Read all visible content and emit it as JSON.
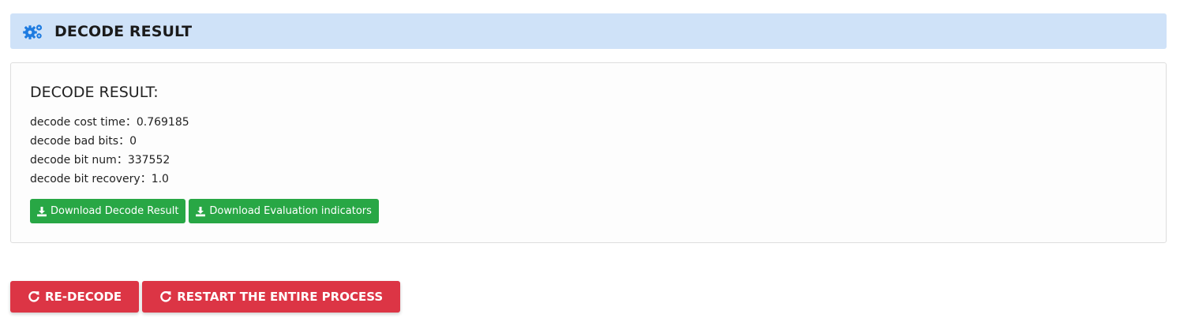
{
  "header": {
    "title": "DECODE RESULT",
    "icon": "gears-icon",
    "background_color": "#cfe2f8",
    "icon_color": "#1e7be0"
  },
  "result": {
    "title": "DECODE RESULT:",
    "stats": [
      {
        "label": "decode cost time：",
        "value": "0.769185"
      },
      {
        "label": "decode bad bits：",
        "value": "0"
      },
      {
        "label": "decode bit num：",
        "value": "337552"
      },
      {
        "label": "decode bit recovery：",
        "value": "1.0"
      }
    ],
    "downloads": [
      {
        "label": "Download Decode Result",
        "icon": "download-icon"
      },
      {
        "label": "Download Evaluation indicators",
        "icon": "download-icon"
      }
    ],
    "download_color": "#28a745"
  },
  "footer": {
    "buttons": [
      {
        "label": "RE-DECODE",
        "icon": "redo-icon"
      },
      {
        "label": "RESTART THE ENTIRE PROCESS",
        "icon": "redo-icon"
      }
    ],
    "button_color": "#dc3545"
  }
}
